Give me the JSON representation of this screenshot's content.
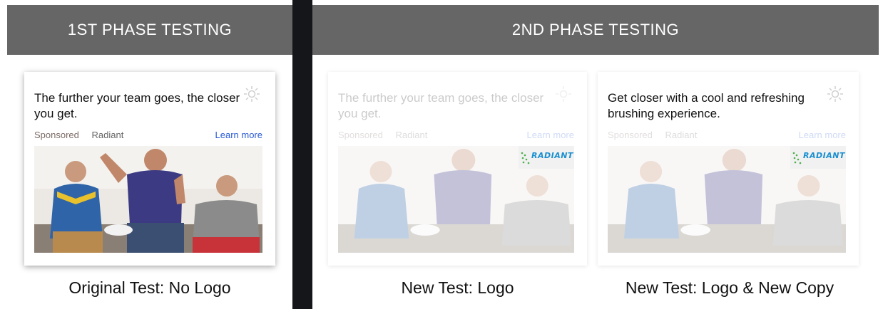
{
  "phase1": {
    "header": "1ST PHASE TESTING",
    "card": {
      "title": "The further your team goes, the closer you get.",
      "sponsored": "Sponsored",
      "brand": "Radiant",
      "learn_more": "Learn more",
      "icon": "sun-icon"
    },
    "caption": "Original Test: No Logo"
  },
  "phase2": {
    "header": "2ND PHASE TESTING",
    "cards": [
      {
        "title": "The further your team goes, the closer you get.",
        "sponsored": "Sponsored",
        "brand": "Radiant",
        "learn_more": "Learn more",
        "logo_text": "RADIANT",
        "icon": "sun-icon",
        "caption": "New Test: Logo"
      },
      {
        "title": "Get closer with a cool and refreshing brushing experience.",
        "sponsored": "Sponsored",
        "brand": "Radiant",
        "learn_more": "Learn more",
        "logo_text": "RADIANT",
        "icon": "sun-icon",
        "caption": "New Test: Logo & New Copy"
      }
    ]
  },
  "colors": {
    "header_bg": "#666666",
    "divider": "#15161a",
    "link": "#2a5bd6",
    "logo": "#1a8fd0"
  }
}
